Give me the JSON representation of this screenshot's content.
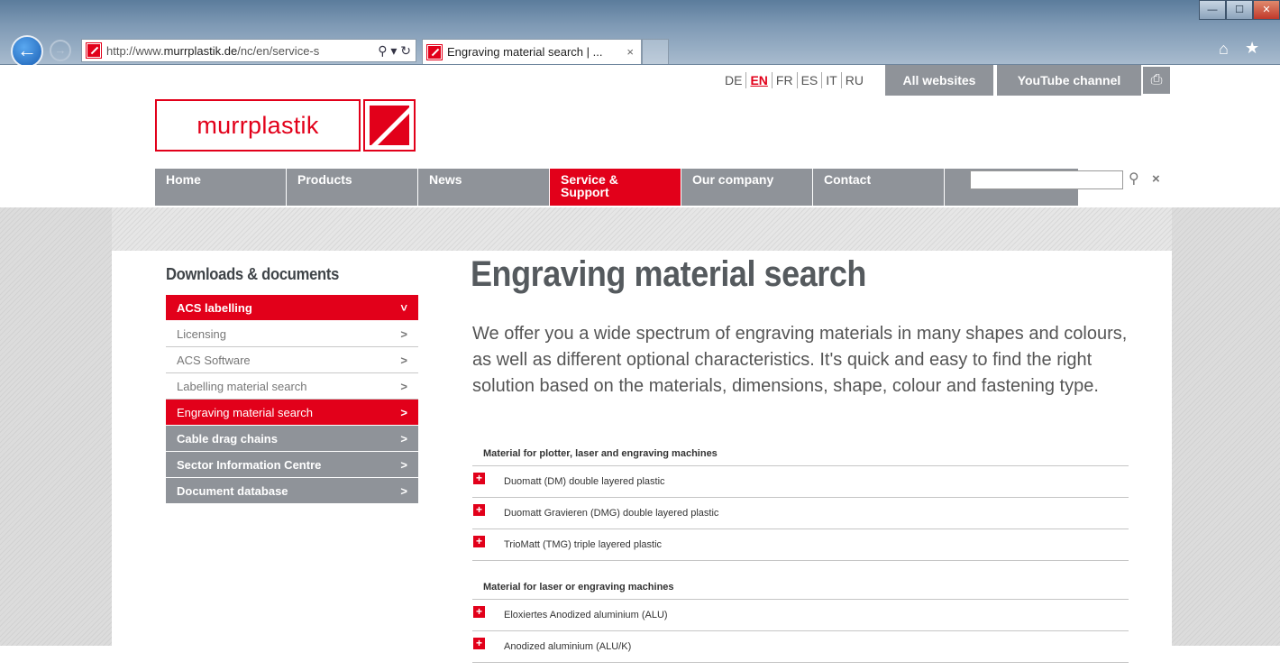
{
  "browser": {
    "address_prefix": "http://www.",
    "address_domain": "murrplastik.de",
    "address_suffix": "/nc/en/service-s",
    "address_controls": "⚲ ▾ ↻",
    "tab_title": "Engraving material search | ...",
    "tab_close": "×"
  },
  "header": {
    "languages": [
      {
        "label": "DE",
        "active": false
      },
      {
        "label": "EN",
        "active": true
      },
      {
        "label": "FR",
        "active": false
      },
      {
        "label": "ES",
        "active": false
      },
      {
        "label": "IT",
        "active": false
      },
      {
        "label": "RU",
        "active": false
      }
    ],
    "all_websites": "All websites",
    "youtube": "YouTube channel",
    "logo_text": "murrplastik"
  },
  "nav": {
    "items": [
      "Home",
      "Products",
      "News",
      "Service & Support",
      "Our company",
      "Contact"
    ],
    "active": "Service & Support",
    "search_clear": "×"
  },
  "sidebar": {
    "heading": "Downloads & documents",
    "items": [
      {
        "label": "ACS labelling",
        "style": "red",
        "arrow": "˅"
      },
      {
        "label": "Licensing",
        "style": "plain",
        "arrow": ">"
      },
      {
        "label": "ACS Software",
        "style": "plain",
        "arrow": ">"
      },
      {
        "label": "Labelling material search",
        "style": "plain",
        "arrow": ">"
      },
      {
        "label": "Engraving material search",
        "style": "red-plain",
        "arrow": ">"
      },
      {
        "label": "Cable drag chains",
        "style": "gray",
        "arrow": ">"
      },
      {
        "label": "Sector Information Centre",
        "style": "gray",
        "arrow": ">"
      },
      {
        "label": "Document database",
        "style": "gray",
        "arrow": ">"
      }
    ]
  },
  "main": {
    "title": "Engraving material search",
    "intro": "We offer you a wide spectrum of engraving materials in many shapes and colours, as well as different optional characteristics. It's quick and easy to find the right solution based on the materials, dimensions, shape, colour and fastening type.",
    "sections": [
      {
        "title": "Material for plotter, laser and engraving machines",
        "items": [
          "Duomatt (DM) double layered plastic",
          "Duomatt Gravieren (DMG) double layered plastic",
          "TrioMatt (TMG) triple layered plastic"
        ]
      },
      {
        "title": "Material for laser or engraving machines",
        "items": [
          "Eloxiertes Anodized aluminium (ALU)",
          "Anodized aluminium (ALU/K)"
        ]
      }
    ]
  },
  "colors": {
    "brand_red": "#e2001a",
    "nav_gray": "#8f9399",
    "text_gray": "#555a5e"
  }
}
